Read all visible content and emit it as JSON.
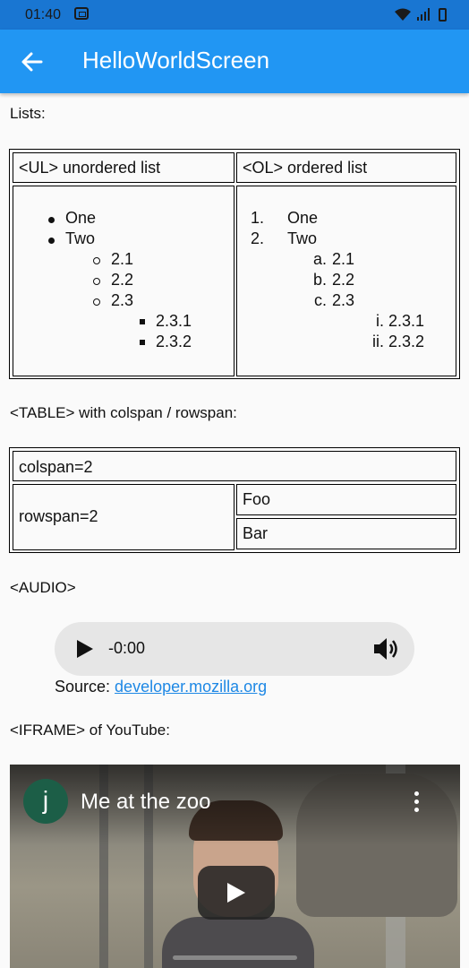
{
  "status_bar": {
    "time": "01:40"
  },
  "app_bar": {
    "title": "HelloWorldScreen"
  },
  "sections": {
    "lists_heading": "Lists:",
    "table_heading": "<TABLE> with colspan / rowspan:",
    "audio_heading": "<AUDIO>",
    "iframe_heading": "<IFRAME> of YouTube:"
  },
  "lists_table": {
    "ul_header": "<UL> unordered list",
    "ol_header": "<OL> ordered list",
    "ul": [
      "One",
      "Two",
      "2.1",
      "2.2",
      "2.3",
      "2.3.1",
      "2.3.2"
    ],
    "ol": [
      {
        "marker": "1.",
        "text": "One"
      },
      {
        "marker": "2.",
        "text": "Two"
      },
      {
        "marker": "a.",
        "text": "2.1"
      },
      {
        "marker": "b.",
        "text": "2.2"
      },
      {
        "marker": "c.",
        "text": "2.3"
      },
      {
        "marker": "i.",
        "text": "2.3.1"
      },
      {
        "marker": "ii.",
        "text": "2.3.2"
      }
    ]
  },
  "span_table": {
    "colspan": "colspan=2",
    "rowspan": "rowspan=2",
    "foo": "Foo",
    "bar": "Bar"
  },
  "audio": {
    "time": "-0:00",
    "source_label": "Source: ",
    "source_link": "developer.mozilla.org"
  },
  "youtube": {
    "channel_initial": "j",
    "video_title": "Me at the zoo"
  }
}
